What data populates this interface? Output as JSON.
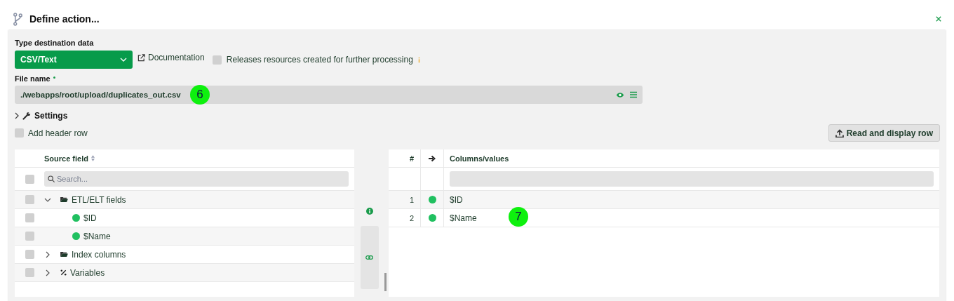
{
  "window": {
    "title": "Define action..."
  },
  "destination": {
    "label": "Type destination data",
    "value": "CSV/Text",
    "documentation": "Documentation",
    "release": {
      "label": "Releases resources created for further processing",
      "checked": false
    }
  },
  "file_name": {
    "label": "File name",
    "required": true,
    "value": "./webapps/root/upload/duplicates_out.csv"
  },
  "settings": {
    "label": "Settings",
    "expanded": false
  },
  "header_row": {
    "label": "Add header row",
    "checked": false
  },
  "read_button": "Read and display row",
  "source": {
    "column": "Source field",
    "select_all": false,
    "search_placeholder": "Search...",
    "tree": [
      {
        "kind": "folder",
        "label": "ETL/ELT fields",
        "expanded": true,
        "checked": false,
        "children": [
          {
            "kind": "field",
            "label": "$ID",
            "checked": false
          },
          {
            "kind": "field",
            "label": "$Name",
            "checked": false
          }
        ]
      },
      {
        "kind": "folder",
        "label": "Index columns",
        "expanded": false,
        "checked": false
      },
      {
        "kind": "variables",
        "label": "Variables",
        "expanded": false,
        "checked": false
      }
    ]
  },
  "target": {
    "columns": [
      "#",
      "Columns/values"
    ],
    "rows": [
      {
        "number": "1",
        "value": "$ID"
      },
      {
        "number": "2",
        "value": "$Name"
      }
    ]
  },
  "annotations": [
    {
      "label": "6"
    },
    {
      "label": "7"
    }
  ]
}
